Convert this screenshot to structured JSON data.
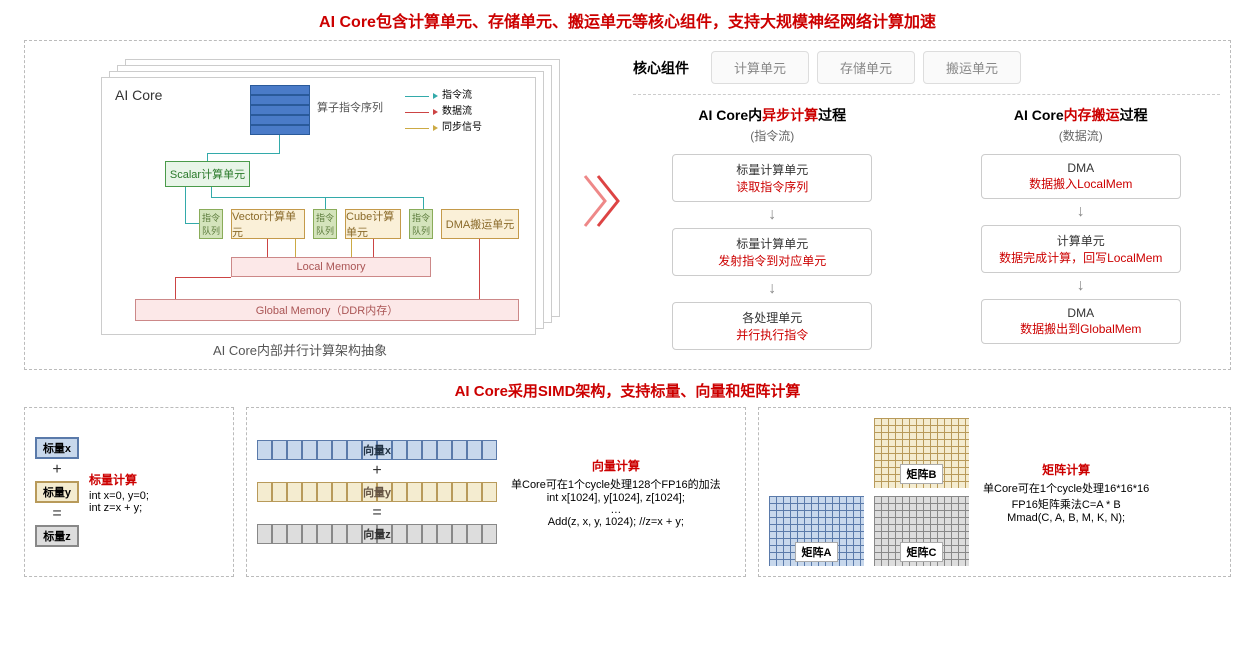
{
  "titles": {
    "main": "AI Core包含计算单元、存储单元、搬运单元等核心组件，支持大规模神经网络计算加速",
    "sub": "AI Core采用SIMD架构，支持标量、向量和矩阵计算"
  },
  "arch": {
    "core_label": "AI Core",
    "queue_label": "算子指令序列",
    "legend": {
      "instr": "指令流",
      "data": "数据流",
      "sync": "同步信号"
    },
    "scalar": "Scalar计算单元",
    "queue_small": "指令\n队列",
    "vector": "Vector计算单元",
    "cube": "Cube计算单元",
    "dma": "DMA搬运单元",
    "localmem": "Local Memory",
    "globalmem": "Global Memory（DDR内存）",
    "caption": "AI Core内部并行计算架构抽象"
  },
  "tabs": {
    "label": "核心组件",
    "t1": "计算单元",
    "t2": "存储单元",
    "t3": "搬运单元"
  },
  "flow1": {
    "title_pre": "AI Core内",
    "title_red": "异步计算",
    "title_post": "过程",
    "sub": "(指令流)",
    "b1a": "标量计算单元",
    "b1b": "读取指令序列",
    "b2a": "标量计算单元",
    "b2b": "发射指令到对应单元",
    "b3a": "各处理单元",
    "b3b": "并行执行指令"
  },
  "flow2": {
    "title_pre": "AI Core",
    "title_red": "内存搬运",
    "title_post": "过程",
    "sub": "(数据流)",
    "b1a": "DMA",
    "b1b": "数据搬入LocalMem",
    "b2a": "计算单元",
    "b2b": "数据完成计算，回写LocalMem",
    "b3a": "DMA",
    "b3b": "数据搬出到GlobalMem"
  },
  "scalar_calc": {
    "x": "标量x",
    "y": "标量y",
    "z": "标量z",
    "plus": "+",
    "eq": "=",
    "title": "标量计算",
    "l1": "int x=0, y=0;",
    "l2": "int z=x + y;"
  },
  "vector_calc": {
    "x": "向量x",
    "y": "向量y",
    "z": "向量z",
    "plus": "+",
    "eq": "=",
    "title": "向量计算",
    "l1": "单Core可在1个cycle处理128个FP16的加法",
    "l2": "int x[1024], y[1024], z[1024];",
    "l3": "…",
    "l4": "Add(z, x, y, 1024); //z=x + y;"
  },
  "matrix_calc": {
    "a": "矩阵A",
    "b": "矩阵B",
    "c": "矩阵C",
    "title": "矩阵计算",
    "l1": "单Core可在1个cycle处理16*16*16",
    "l2": "FP16矩阵乘法C=A * B",
    "l3": "Mmad(C, A, B, M, K, N);"
  }
}
